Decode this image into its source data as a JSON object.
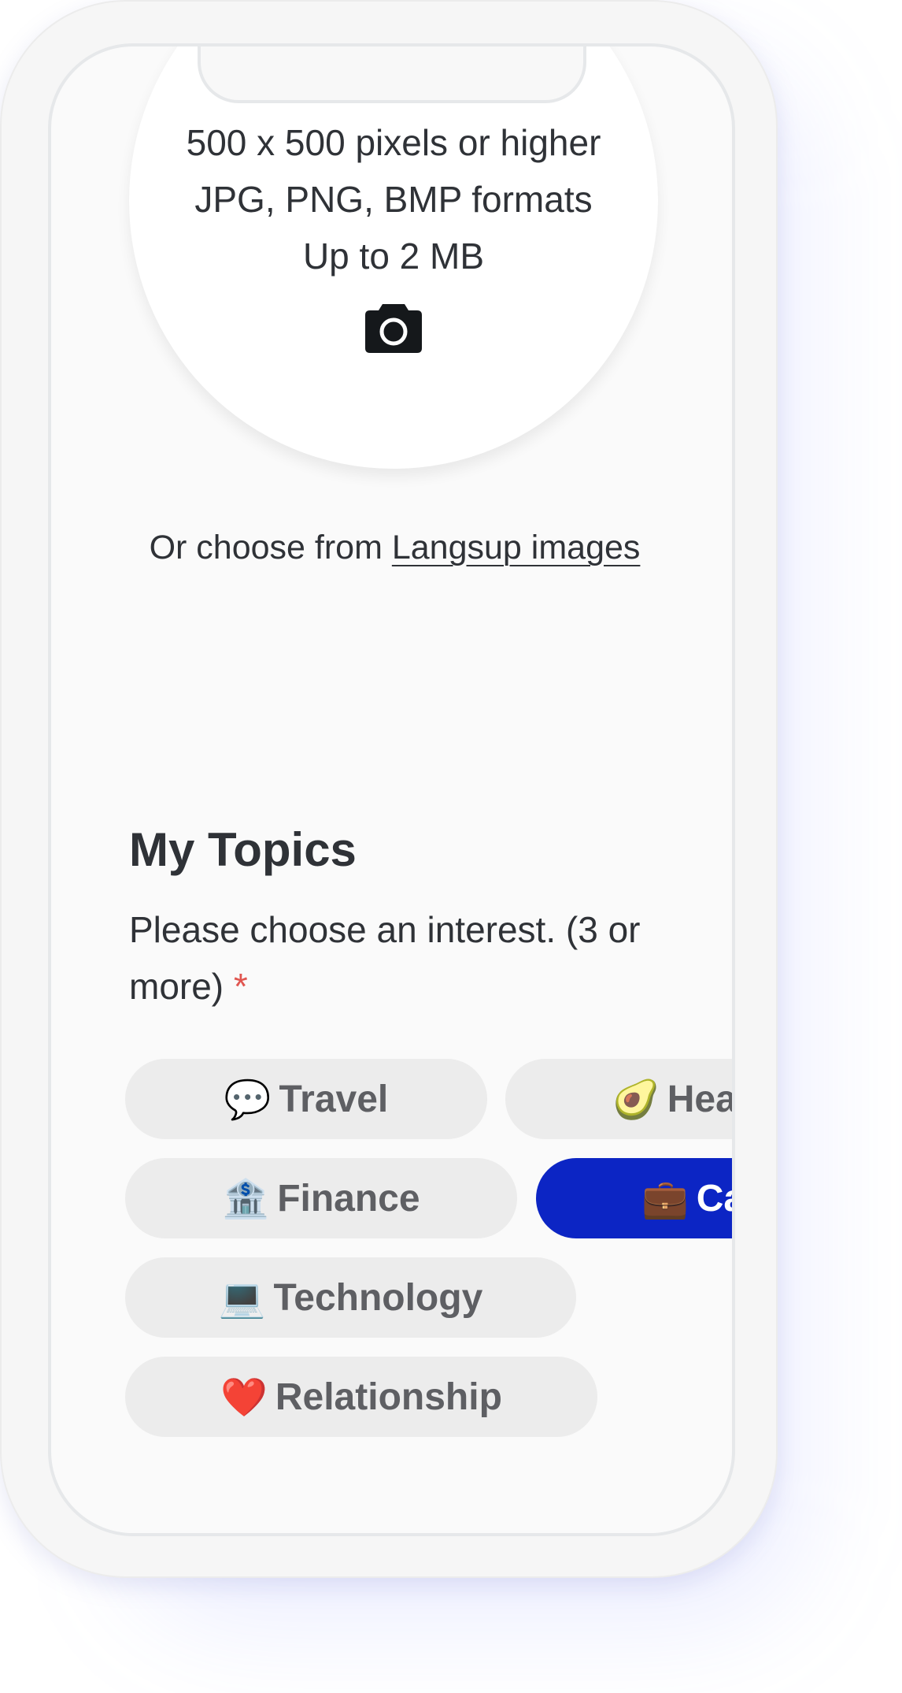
{
  "upload": {
    "line1": "500 x 500 pixels or higher",
    "line2": "JPG, PNG, BMP formats",
    "line3": "Up to 2 MB",
    "camera_icon": "camera-icon"
  },
  "choose": {
    "prefix": "Or choose from ",
    "link": "Langsup images"
  },
  "topics": {
    "title": "My Topics",
    "subtitle": "Please choose an interest. (3 or more)",
    "required_mark": "*",
    "chips": [
      {
        "emoji": "💬",
        "label": "Travel",
        "selected": false
      },
      {
        "emoji": "🥑",
        "label": "Heal",
        "selected": false
      },
      {
        "emoji": "🏦",
        "label": "Finance",
        "selected": false
      },
      {
        "emoji": "💼",
        "label": "Ca",
        "selected": true
      },
      {
        "emoji": "💻",
        "label": "Technology",
        "selected": false
      },
      {
        "emoji": "❤️",
        "label": "Relationship",
        "selected": false
      }
    ]
  },
  "colors": {
    "accent": "#0c25c4",
    "chip_bg": "#ececec",
    "text": "#2f3237",
    "required": "#e0554f"
  }
}
